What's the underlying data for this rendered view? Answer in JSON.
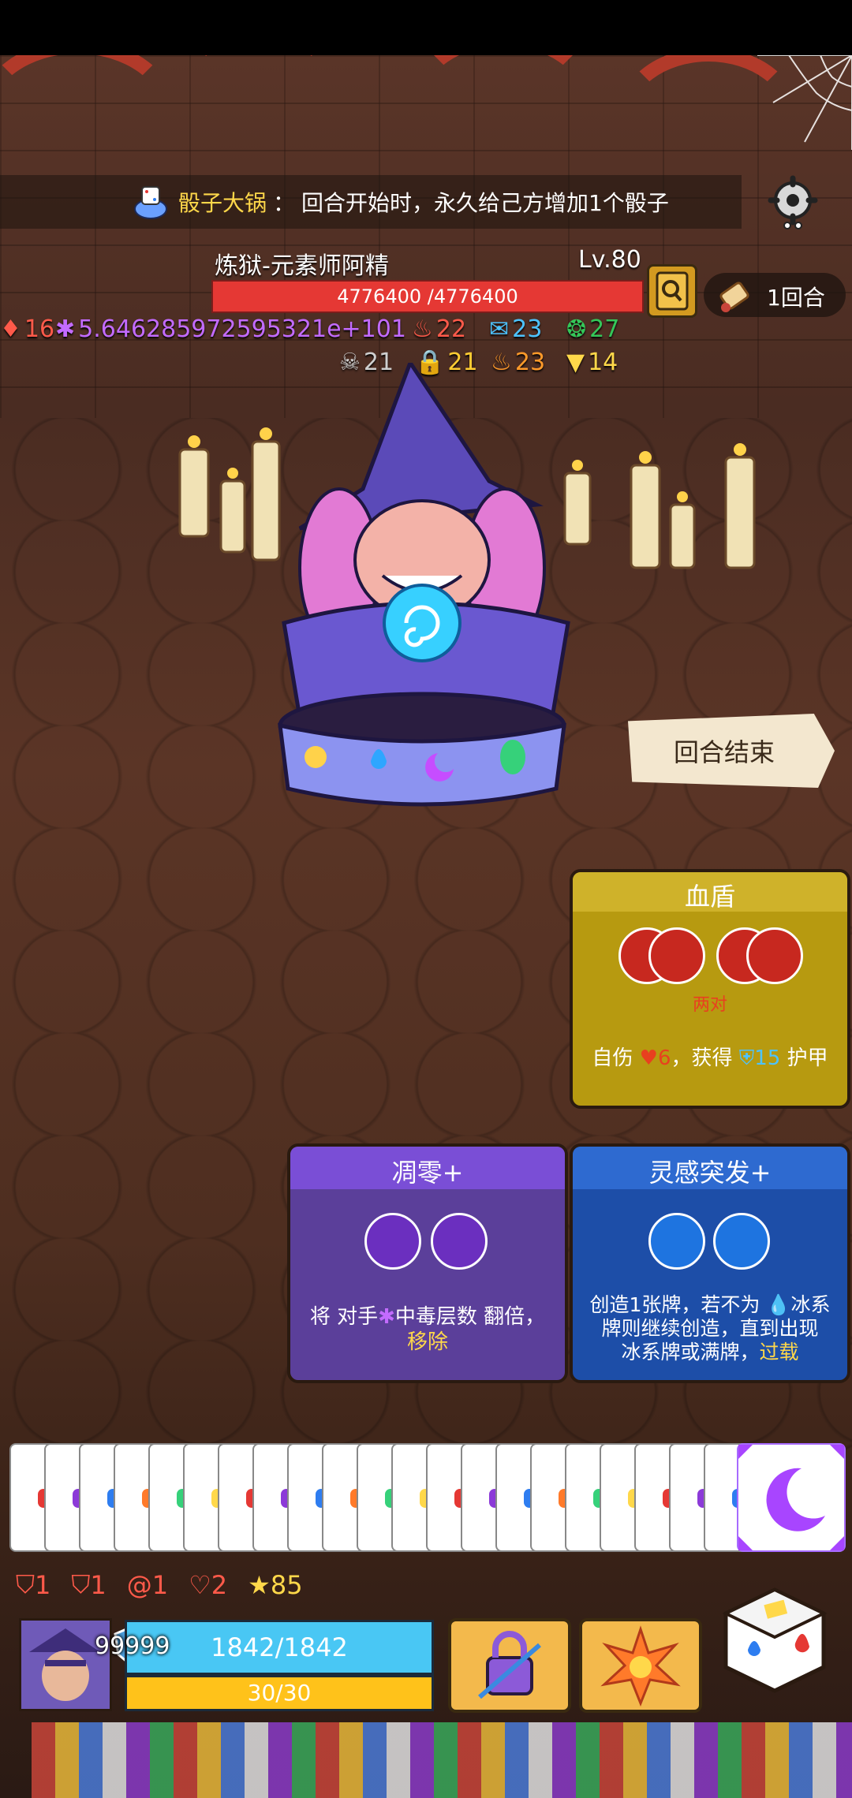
{
  "banner": {
    "title": "骰子大锅",
    "sep": "：",
    "desc": "回合开始时，永久给己方增加1个骰子"
  },
  "enemy": {
    "name": "炼狱-元素师阿精",
    "level": "Lv.80",
    "hp_text": "4776400 /4776400",
    "hp_fraction": 1.0
  },
  "turn": {
    "label": "1回合"
  },
  "enemy_stats_row1": [
    {
      "icon": "fire-drop-icon",
      "value": "16",
      "color": "#ff5a4a"
    },
    {
      "icon": "poison-icon",
      "value": "5.646285972595321e+101",
      "color": "#c36bff"
    },
    {
      "icon": "flame-icon",
      "value": "22",
      "color": "#ff5a4a"
    },
    {
      "icon": "speech-icon",
      "value": "23",
      "color": "#4dc3ff"
    },
    {
      "icon": "swirl-icon",
      "value": "27",
      "color": "#34c759"
    }
  ],
  "enemy_stats_row2": [
    {
      "icon": "skull-icon",
      "value": "21",
      "color": "#cfcfcf"
    },
    {
      "icon": "lock-icon",
      "value": "21",
      "color": "#ffcc33"
    },
    {
      "icon": "burn-icon",
      "value": "23",
      "color": "#ff9a2a"
    },
    {
      "icon": "triangle-icon",
      "value": "14",
      "color": "#ffd84a"
    }
  ],
  "end_turn_button": "回合结束",
  "cards": {
    "blood_shield": {
      "title": "血盾",
      "sub": "两对",
      "desc_pre": "自伤 ",
      "self_damage": "6",
      "desc_mid": "，获得 ",
      "armor": "15",
      "desc_post": " 护甲"
    },
    "wither": {
      "title": "凋零+",
      "desc_a": "将 对手",
      "desc_b": "中毒层数 翻倍，",
      "desc_c": "移除"
    },
    "inspiration": {
      "title": "灵感突发+",
      "desc_a": "创造1张牌，若不为 ",
      "desc_b": "冰系",
      "desc_c": "牌则继续创造，直到出现",
      "desc_d": "冰系牌或满牌，",
      "desc_e": "过载"
    }
  },
  "status": [
    {
      "icon": "fist-shield-icon",
      "value": "1",
      "color": "#ff5a4a"
    },
    {
      "icon": "broken-shield-icon",
      "value": "1",
      "color": "#ff5a4a"
    },
    {
      "icon": "spiral-icon",
      "value": "1",
      "color": "#ff5a4a"
    },
    {
      "icon": "heart-shield-icon",
      "value": "2",
      "color": "#ff5a4a"
    },
    {
      "icon": "star-icon",
      "value": "85",
      "color": "#ffd84a"
    }
  ],
  "player": {
    "shield": "99999",
    "hp": "1842/1842",
    "energy": "30/30"
  }
}
